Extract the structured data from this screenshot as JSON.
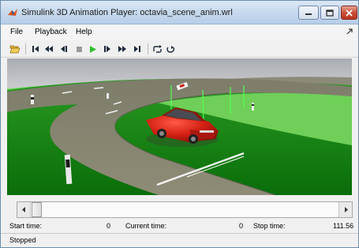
{
  "window": {
    "title": "Simulink 3D Animation Player: octavia_scene_anim.wrl",
    "icon": "matlab-logo-icon"
  },
  "menu": {
    "items": [
      "File",
      "Playback",
      "Help"
    ]
  },
  "toolbar": {
    "icons": [
      "open-folder-icon",
      "go-to-start-icon",
      "rewind-icon",
      "step-back-icon",
      "stop-icon",
      "play-icon",
      "step-forward-icon",
      "fast-forward-icon",
      "go-to-end-icon",
      "repeat-icon",
      "loop-icon"
    ],
    "play_color": "#2fbf2f"
  },
  "times": {
    "start_label": "Start time:",
    "start_value": "0",
    "current_label": "Current time:",
    "current_value": "0",
    "stop_label": "Stop time:",
    "stop_value": "111.56"
  },
  "status": {
    "text": "Stopped"
  },
  "colors": {
    "grass": "#0f7d0f",
    "road": "#8b8b72",
    "car": "#c81e14",
    "sky": "#b9bcc0"
  }
}
